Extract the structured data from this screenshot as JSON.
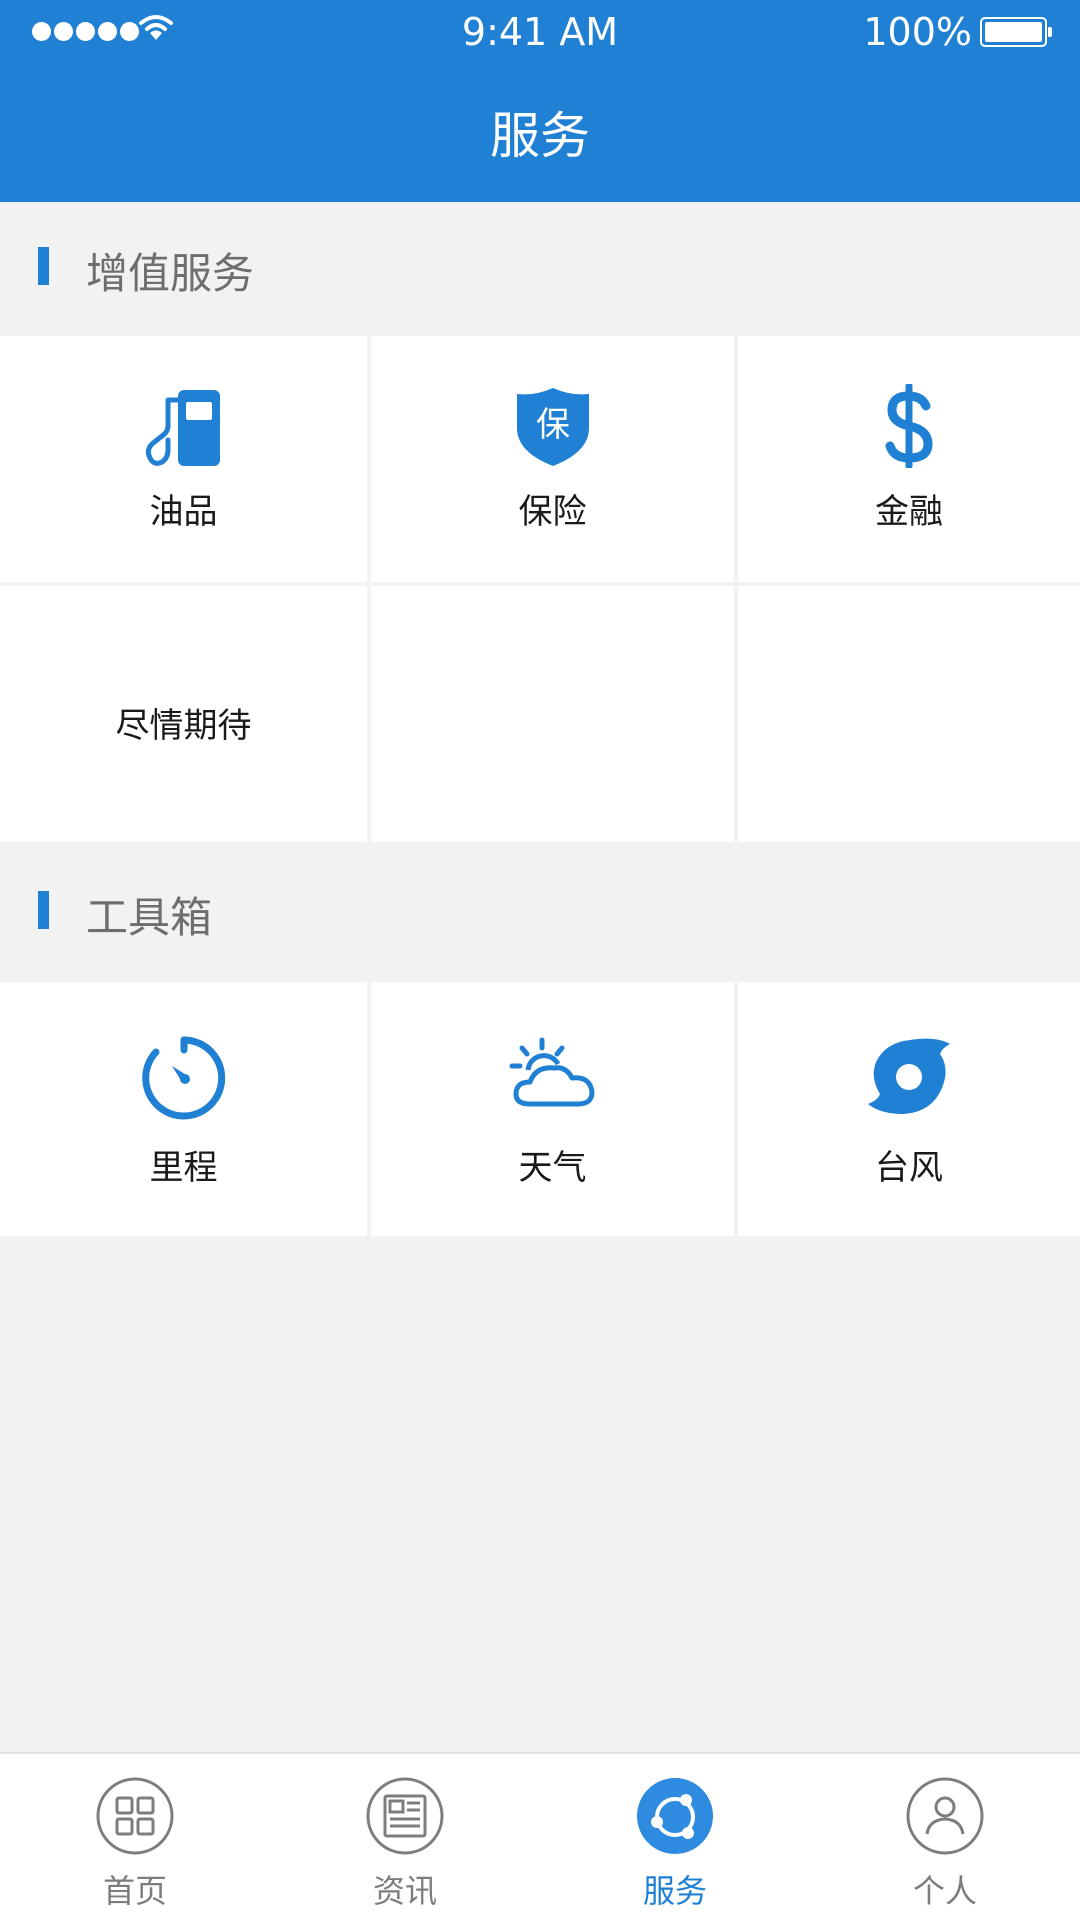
{
  "status_bar": {
    "time": "9:41 AM",
    "battery": "100%"
  },
  "nav": {
    "title": "服务"
  },
  "sections": [
    {
      "title": "增值服务",
      "items": [
        {
          "label": "油品",
          "icon": "fuel-pump-icon"
        },
        {
          "label": "保险",
          "icon": "insurance-shield-icon",
          "icon_text": "保"
        },
        {
          "label": "金融",
          "icon": "dollar-icon"
        },
        {
          "label": "尽情期待",
          "icon": ""
        }
      ]
    },
    {
      "title": "工具箱",
      "items": [
        {
          "label": "里程",
          "icon": "speedometer-icon"
        },
        {
          "label": "天气",
          "icon": "weather-icon"
        },
        {
          "label": "台风",
          "icon": "typhoon-icon"
        }
      ]
    }
  ],
  "tabs": [
    {
      "label": "首页",
      "icon": "home-grid-icon",
      "active": false
    },
    {
      "label": "资讯",
      "icon": "news-icon",
      "active": false
    },
    {
      "label": "服务",
      "icon": "service-icon",
      "active": true
    },
    {
      "label": "个人",
      "icon": "person-icon",
      "active": false
    }
  ],
  "colors": {
    "primary": "#2080d4",
    "background": "#f2f2f2",
    "text": "#1a1a1a",
    "section_title": "#6e6e6e",
    "tab_inactive": "#7d7d7d"
  }
}
